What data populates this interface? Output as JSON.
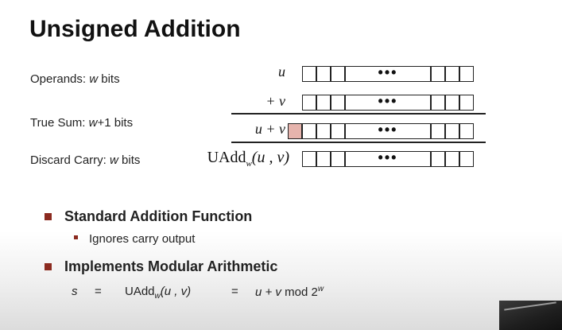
{
  "title": "Unsigned Addition",
  "rows": [
    {
      "label_prefix": "Operands: ",
      "label_var": "w",
      "label_suffix": " bits",
      "expr_main": "u",
      "expr_sub": "",
      "expr_args": "",
      "carry": false
    },
    {
      "label_prefix": "",
      "label_var": "",
      "label_suffix": "",
      "expr_main": "+ v",
      "expr_sub": "",
      "expr_args": "",
      "carry": false
    },
    {
      "label_prefix": "True Sum: ",
      "label_var": "w",
      "label_suffix": "+1 bits",
      "expr_main": "u + v",
      "expr_sub": "",
      "expr_args": "",
      "carry": true
    },
    {
      "label_prefix": "Discard Carry: ",
      "label_var": "w",
      "label_suffix": " bits",
      "expr_main": "UAdd",
      "expr_sub": "w",
      "expr_args": "(u , v)",
      "carry": false
    }
  ],
  "ellipsis": "•••",
  "bullets": [
    {
      "text": "Standard Addition Function",
      "sub": "Ignores carry output"
    },
    {
      "text": "Implements Modular Arithmetic",
      "sub": ""
    }
  ],
  "equation": {
    "lhs": "s",
    "eq1": "=",
    "func": "UAdd",
    "func_sub": "w",
    "func_args": "(u , v)",
    "eq2": "=",
    "rhs": "u + v",
    "mod": "mod 2",
    "exp": "w"
  },
  "colors": {
    "bullet": "#8b2a1f",
    "carry_cell": "#e6b4ad"
  }
}
